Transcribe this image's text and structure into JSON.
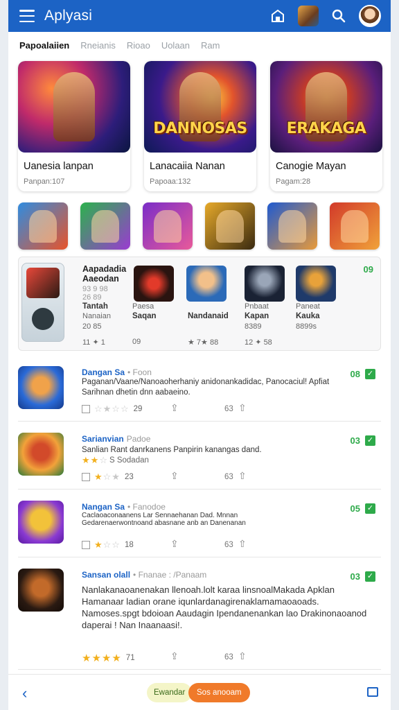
{
  "app": {
    "title": "Aplyasi"
  },
  "tabs": [
    "Papoalaiien",
    "Rneianis",
    "Rioao",
    "Uolaan",
    "Ram"
  ],
  "featured": [
    {
      "title": "Uanesia lanpan",
      "subtitle": "Panpan:107",
      "logo": ""
    },
    {
      "title": "Lanacaiia Nanan",
      "subtitle": "Papoaa:132",
      "logo": "DANNOSAS"
    },
    {
      "title": "Canogie Mayan",
      "subtitle": "Pagam:28",
      "logo": "ERAKAGA"
    }
  ],
  "collection": {
    "title_line1": "Aapadadia",
    "title_line2": "Aaeodan",
    "nums_line1": "93 9 98",
    "nums_line2": "26 89",
    "badge": "09",
    "items": [
      {
        "name": "Tantah",
        "sub": "Nanaian",
        "nums": "20 85",
        "rating": "11 ✦ 1"
      },
      {
        "name": "Paesa",
        "sub": "Saqan",
        "nums": "",
        "rating": "09"
      },
      {
        "name": "",
        "sub": "Nandanaid",
        "nums": "",
        "rating": "★ 7★ 88"
      },
      {
        "name": "Pnbaat",
        "sub": "Kapan",
        "nums": "8389",
        "rating": "12 ✦ 58"
      },
      {
        "name": "Paneat",
        "sub": "Kauka",
        "nums": "8899s",
        "rating": ""
      }
    ]
  },
  "list": [
    {
      "title": "Dangan Sa",
      "sub": "• Foon",
      "desc": "Paganan/Vaane/Nanoaoherhaniy anidonankadidac, Panocaciul! Apfiat Sarihnan dhetin dnn aabaeino.",
      "badge": "08",
      "stars_on": 0,
      "rating": "29",
      "count": "63"
    },
    {
      "title": "Sarianvian",
      "sub": "Padoe",
      "desc": "Sanlian Rant danrkanens Panpirin kanangas dand.",
      "desc2": "S Sodadan",
      "badge": "03",
      "stars_on": 1,
      "rating": "23",
      "count": "63"
    },
    {
      "title": "Nangan Sa",
      "sub": "• Fanodoe",
      "desc": "Caclaoaconaanens Lar Sennaehanan Dad. Mnnan Gedarenaerwontnoand abasnane anb an Danenanan anaanan anagan.",
      "badge": "05",
      "stars_on": 1,
      "rating": "18",
      "count": "63"
    },
    {
      "title": "Sansan olall",
      "sub": "• Fnanae : /Panaam",
      "desc": "Nanlakanaoanenakan llenoah.lolt karaa linsnoalMakada Apklan Hamanaar ladian orane iqunlardanagirenaklamamaoaoads. Namoses.spgt bdoioan Aaudagin Ipendanenankan lao Drakinonaoanod daperai ! Nan Inaanaasi!.",
      "badge": "03",
      "stars_on": 4,
      "rating": "71",
      "count": "63"
    }
  ],
  "bottom": {
    "btn_primary": "Ewandar",
    "btn_secondary": "Sos anooam"
  }
}
